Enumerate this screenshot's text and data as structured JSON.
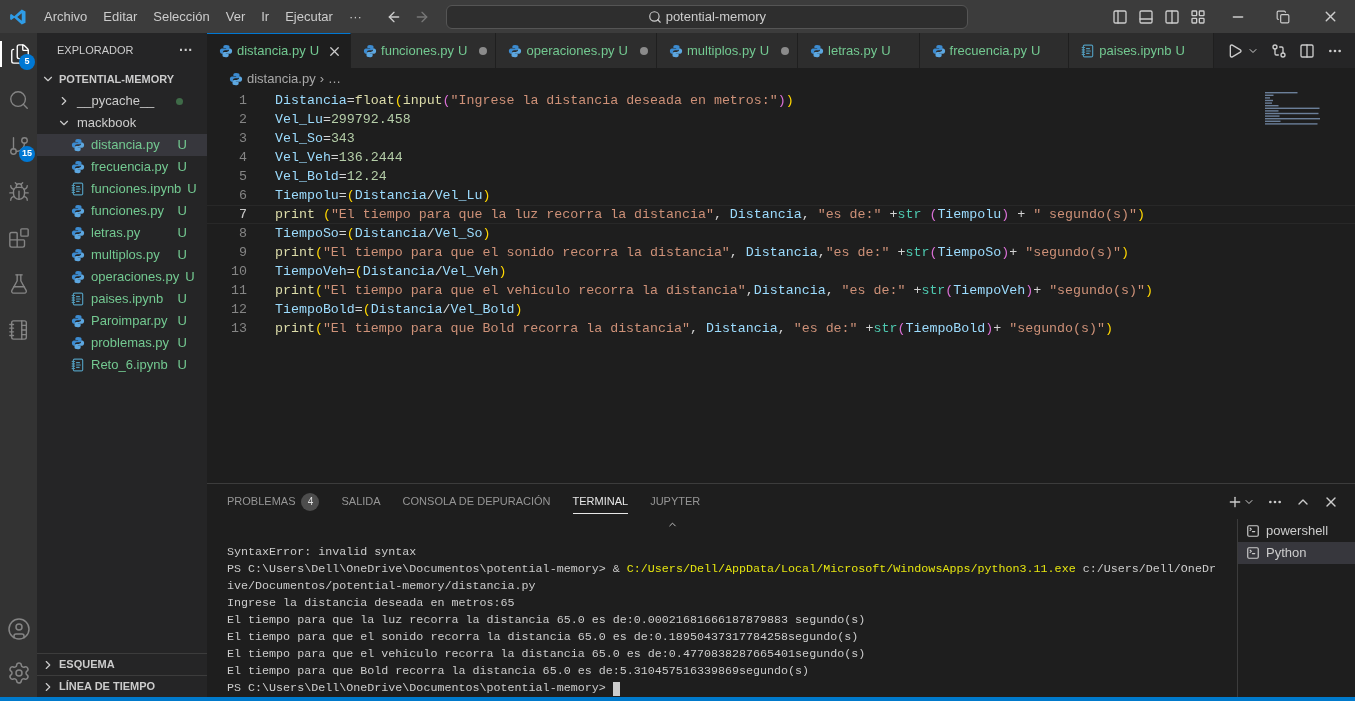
{
  "menu": [
    "Archivo",
    "Editar",
    "Selección",
    "Ver",
    "Ir",
    "Ejecutar",
    "···"
  ],
  "command_center": {
    "value": "potential-memory"
  },
  "activity_bar": [
    {
      "kind": "explorer",
      "badge": "5",
      "selected": true
    },
    {
      "kind": "search",
      "selected": false
    },
    {
      "kind": "source-control",
      "badge": "15",
      "selected": false
    },
    {
      "kind": "run",
      "selected": false
    },
    {
      "kind": "extensions",
      "selected": false
    },
    {
      "kind": "testing",
      "selected": false
    },
    {
      "kind": "notebook",
      "selected": false
    }
  ],
  "sidebar": {
    "title": "EXPLORADOR",
    "more": "···",
    "folder": {
      "name": "POTENTIAL-MEMORY",
      "expanded": true,
      "children": [
        {
          "name": "__pycache__",
          "kind": "folder",
          "expanded": false,
          "modified_dot": true,
          "selected": false
        },
        {
          "name": "mackbook",
          "kind": "folder",
          "expanded": true,
          "selected": false,
          "children": [
            {
              "name": "distancia.py",
              "kind": "py",
              "status": "U",
              "selected": true
            },
            {
              "name": "frecuencia.py",
              "kind": "py",
              "status": "U",
              "selected": false
            },
            {
              "name": "funciones.ipynb",
              "kind": "ipynb",
              "status": "U",
              "selected": false
            },
            {
              "name": "funciones.py",
              "kind": "py",
              "status": "U",
              "selected": false
            },
            {
              "name": "letras.py",
              "kind": "py",
              "status": "U",
              "selected": false
            },
            {
              "name": "multiplos.py",
              "kind": "py",
              "status": "U",
              "selected": false
            },
            {
              "name": "operaciones.py",
              "kind": "py",
              "status": "U",
              "selected": false
            },
            {
              "name": "paises.ipynb",
              "kind": "ipynb",
              "status": "U",
              "selected": false
            },
            {
              "name": "Paroimpar.py",
              "kind": "py",
              "status": "U",
              "selected": false
            },
            {
              "name": "problemas.py",
              "kind": "py",
              "status": "U",
              "selected": false
            },
            {
              "name": "Reto_6.ipynb",
              "kind": "ipynb",
              "status": "U",
              "selected": false
            }
          ]
        }
      ]
    },
    "sections": [
      {
        "name": "ESQUEMA",
        "expanded": false
      },
      {
        "name": "LÍNEA DE TIEMPO",
        "expanded": false
      }
    ]
  },
  "tabs": [
    {
      "name": "distancia.py",
      "kind": "py",
      "status": "U",
      "selected": true,
      "dirty": false
    },
    {
      "name": "funciones.py",
      "kind": "py",
      "status": "U",
      "selected": false,
      "dirty": true
    },
    {
      "name": "operaciones.py",
      "kind": "py",
      "status": "U",
      "selected": false,
      "dirty": true
    },
    {
      "name": "multiplos.py",
      "kind": "py",
      "status": "U",
      "selected": false,
      "dirty": true
    },
    {
      "name": "letras.py",
      "kind": "py",
      "status": "U",
      "selected": false,
      "dirty": false
    },
    {
      "name": "frecuencia.py",
      "kind": "py",
      "status": "U",
      "selected": false,
      "dirty": false
    },
    {
      "name": "paises.ipynb",
      "kind": "ipynb",
      "status": "U",
      "selected": false,
      "dirty": false
    }
  ],
  "breadcrumb": {
    "file": "distancia.py",
    "separator": "›",
    "rest": "…"
  },
  "code": [
    {
      "number": "1",
      "current": false,
      "tokens": [
        {
          "text": "Distancia",
          "kind": "v"
        },
        {
          "text": "=",
          "kind": "o"
        },
        {
          "text": "float",
          "kind": "f"
        },
        {
          "text": "(",
          "kind": "p1"
        },
        {
          "text": "input",
          "kind": "f"
        },
        {
          "text": "(",
          "kind": "p2"
        },
        {
          "text": "\"Ingrese la distancia deseada en metros:\"",
          "kind": "s"
        },
        {
          "text": ")",
          "kind": "p2"
        },
        {
          "text": ")",
          "kind": "p1"
        }
      ]
    },
    {
      "number": "2",
      "current": false,
      "tokens": [
        {
          "text": "Vel_Lu",
          "kind": "v"
        },
        {
          "text": "=",
          "kind": "o"
        },
        {
          "text": "299792.458",
          "kind": "n"
        }
      ]
    },
    {
      "number": "3",
      "current": false,
      "tokens": [
        {
          "text": "Vel_So",
          "kind": "v"
        },
        {
          "text": "=",
          "kind": "o"
        },
        {
          "text": "343",
          "kind": "n"
        }
      ]
    },
    {
      "number": "4",
      "current": false,
      "tokens": [
        {
          "text": "Vel_Veh",
          "kind": "v"
        },
        {
          "text": "=",
          "kind": "o"
        },
        {
          "text": "136.2444",
          "kind": "n"
        }
      ]
    },
    {
      "number": "5",
      "current": false,
      "tokens": [
        {
          "text": "Vel_Bold",
          "kind": "v"
        },
        {
          "text": "=",
          "kind": "o"
        },
        {
          "text": "12.24",
          "kind": "n"
        }
      ]
    },
    {
      "number": "6",
      "current": false,
      "tokens": [
        {
          "text": "Tiempolu",
          "kind": "v"
        },
        {
          "text": "=",
          "kind": "o"
        },
        {
          "text": "(",
          "kind": "p1"
        },
        {
          "text": "Distancia",
          "kind": "v"
        },
        {
          "text": "/",
          "kind": "o"
        },
        {
          "text": "Vel_Lu",
          "kind": "v"
        },
        {
          "text": ")",
          "kind": "p1"
        }
      ]
    },
    {
      "number": "7",
      "current": true,
      "tokens": [
        {
          "text": "print ",
          "kind": "f"
        },
        {
          "text": "(",
          "kind": "p1"
        },
        {
          "text": "\"El tiempo para que la luz recorra la distancia\"",
          "kind": "s"
        },
        {
          "text": ", ",
          "kind": "o"
        },
        {
          "text": "Distancia",
          "kind": "v"
        },
        {
          "text": ", ",
          "kind": "o"
        },
        {
          "text": "\"es de:\"",
          "kind": "s"
        },
        {
          "text": " +",
          "kind": "o"
        },
        {
          "text": "str ",
          "kind": "b"
        },
        {
          "text": "(",
          "kind": "p2"
        },
        {
          "text": "Tiempolu",
          "kind": "v"
        },
        {
          "text": ")",
          "kind": "p2"
        },
        {
          "text": " + ",
          "kind": "o"
        },
        {
          "text": "\" segundo(s)\"",
          "kind": "s"
        },
        {
          "text": ")",
          "kind": "p1"
        }
      ]
    },
    {
      "number": "8",
      "current": false,
      "tokens": [
        {
          "text": "TiempoSo",
          "kind": "v"
        },
        {
          "text": "=",
          "kind": "o"
        },
        {
          "text": "(",
          "kind": "p1"
        },
        {
          "text": "Distancia",
          "kind": "v"
        },
        {
          "text": "/",
          "kind": "o"
        },
        {
          "text": "Vel_So",
          "kind": "v"
        },
        {
          "text": ")",
          "kind": "p1"
        }
      ]
    },
    {
      "number": "9",
      "current": false,
      "tokens": [
        {
          "text": "print",
          "kind": "f"
        },
        {
          "text": "(",
          "kind": "p1"
        },
        {
          "text": "\"El tiempo para que el sonido recorra la distancia\"",
          "kind": "s"
        },
        {
          "text": ", ",
          "kind": "o"
        },
        {
          "text": "Distancia",
          "kind": "v"
        },
        {
          "text": ",",
          "kind": "o"
        },
        {
          "text": "\"es de:\"",
          "kind": "s"
        },
        {
          "text": " +",
          "kind": "o"
        },
        {
          "text": "str",
          "kind": "b"
        },
        {
          "text": "(",
          "kind": "p2"
        },
        {
          "text": "TiempoSo",
          "kind": "v"
        },
        {
          "text": ")",
          "kind": "p2"
        },
        {
          "text": "+ ",
          "kind": "o"
        },
        {
          "text": "\"segundo(s)\"",
          "kind": "s"
        },
        {
          "text": ")",
          "kind": "p1"
        }
      ]
    },
    {
      "number": "10",
      "current": false,
      "tokens": [
        {
          "text": "TiempoVeh",
          "kind": "v"
        },
        {
          "text": "=",
          "kind": "o"
        },
        {
          "text": "(",
          "kind": "p1"
        },
        {
          "text": "Distancia",
          "kind": "v"
        },
        {
          "text": "/",
          "kind": "o"
        },
        {
          "text": "Vel_Veh",
          "kind": "v"
        },
        {
          "text": ")",
          "kind": "p1"
        }
      ]
    },
    {
      "number": "11",
      "current": false,
      "tokens": [
        {
          "text": "print",
          "kind": "f"
        },
        {
          "text": "(",
          "kind": "p1"
        },
        {
          "text": "\"El tiempo para que el vehiculo recorra la distancia\"",
          "kind": "s"
        },
        {
          "text": ",",
          "kind": "o"
        },
        {
          "text": "Distancia",
          "kind": "v"
        },
        {
          "text": ", ",
          "kind": "o"
        },
        {
          "text": "\"es de:\"",
          "kind": "s"
        },
        {
          "text": " +",
          "kind": "o"
        },
        {
          "text": "str",
          "kind": "b"
        },
        {
          "text": "(",
          "kind": "p2"
        },
        {
          "text": "TiempoVeh",
          "kind": "v"
        },
        {
          "text": ")",
          "kind": "p2"
        },
        {
          "text": "+ ",
          "kind": "o"
        },
        {
          "text": "\"segundo(s)\"",
          "kind": "s"
        },
        {
          "text": ")",
          "kind": "p1"
        }
      ]
    },
    {
      "number": "12",
      "current": false,
      "tokens": [
        {
          "text": "TiempoBold",
          "kind": "v"
        },
        {
          "text": "=",
          "kind": "o"
        },
        {
          "text": "(",
          "kind": "p1"
        },
        {
          "text": "Distancia",
          "kind": "v"
        },
        {
          "text": "/",
          "kind": "o"
        },
        {
          "text": "Vel_Bold",
          "kind": "v"
        },
        {
          "text": ")",
          "kind": "p1"
        }
      ]
    },
    {
      "number": "13",
      "current": false,
      "tokens": [
        {
          "text": "print",
          "kind": "f"
        },
        {
          "text": "(",
          "kind": "p1"
        },
        {
          "text": "\"El tiempo para que Bold recorra la distancia\"",
          "kind": "s"
        },
        {
          "text": ", ",
          "kind": "o"
        },
        {
          "text": "Distancia",
          "kind": "v"
        },
        {
          "text": ", ",
          "kind": "o"
        },
        {
          "text": "\"es de:\"",
          "kind": "s"
        },
        {
          "text": " +",
          "kind": "o"
        },
        {
          "text": "str",
          "kind": "b"
        },
        {
          "text": "(",
          "kind": "p2"
        },
        {
          "text": "TiempoBold",
          "kind": "v"
        },
        {
          "text": ")",
          "kind": "p2"
        },
        {
          "text": "+ ",
          "kind": "o"
        },
        {
          "text": "\"segundo(s)\"",
          "kind": "s"
        },
        {
          "text": ")",
          "kind": "p1"
        }
      ]
    }
  ],
  "panel": {
    "tabs": [
      {
        "label": "PROBLEMAS",
        "badge": "4",
        "selected": false
      },
      {
        "label": "SALIDA",
        "selected": false
      },
      {
        "label": "CONSOLA DE DEPURACIÓN",
        "selected": false
      },
      {
        "label": "TERMINAL",
        "selected": true
      },
      {
        "label": "JUPYTER",
        "selected": false
      }
    ],
    "terminal": [
      [
        {
          "text": "SyntaxError: invalid syntax",
          "kind": "plain"
        }
      ],
      [
        {
          "text": "PS C:\\Users\\Dell\\OneDrive\\Documentos\\potential-memory> & ",
          "kind": "plain"
        },
        {
          "text": "C:/Users/Dell/AppData/Local/Microsoft/WindowsApps/python3.11.exe",
          "kind": "cmd"
        },
        {
          "text": " c:/Users/Dell/OneDr",
          "kind": "plain"
        }
      ],
      [
        {
          "text": "ive/Documentos/potential-memory/distancia.py",
          "kind": "plain"
        }
      ],
      [
        {
          "text": "Ingrese la distancia deseada en metros:65",
          "kind": "plain"
        }
      ],
      [
        {
          "text": "El tiempo para que la luz recorra la distancia 65.0 es de:0.00021681666187879883 segundo(s)",
          "kind": "plain"
        }
      ],
      [
        {
          "text": "El tiempo para que el sonido recorra la distancia 65.0 es de:0.18950437317784258segundo(s)",
          "kind": "plain"
        }
      ],
      [
        {
          "text": "El tiempo para que el vehiculo recorra la distancia 65.0 es de:0.4770838287665401segundo(s)",
          "kind": "plain"
        }
      ],
      [
        {
          "text": "El tiempo para que Bold recorra la distancia 65.0 es de:5.310457516339869segundo(s)",
          "kind": "plain"
        }
      ],
      [
        {
          "text": "PS C:\\Users\\Dell\\OneDrive\\Documentos\\potential-memory> ",
          "kind": "plain"
        }
      ]
    ],
    "terminals": [
      {
        "name": "powershell",
        "selected": false
      },
      {
        "name": "Python",
        "selected": true
      }
    ]
  }
}
